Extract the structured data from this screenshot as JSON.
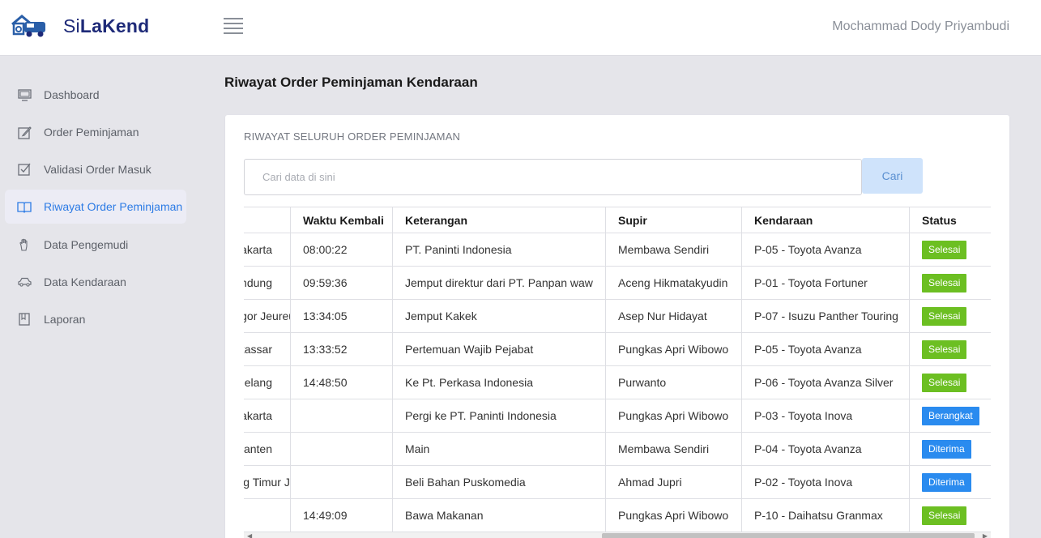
{
  "app": {
    "name_prefix": "Si",
    "name_bold": "LaKend",
    "user_name": "Mochammad Dody Priyambudi"
  },
  "sidebar": {
    "items": [
      {
        "label": "Dashboard",
        "icon": "monitor-icon",
        "active": false
      },
      {
        "label": "Order Peminjaman",
        "icon": "edit-icon",
        "active": false
      },
      {
        "label": "Validasi Order Masuk",
        "icon": "checkbox-icon",
        "active": false
      },
      {
        "label": "Riwayat Order Peminjaman",
        "icon": "book-icon",
        "active": true
      },
      {
        "label": "Data Pengemudi",
        "icon": "hand-icon",
        "active": false
      },
      {
        "label": "Data Kendaraan",
        "icon": "car-icon",
        "active": false
      },
      {
        "label": "Laporan",
        "icon": "report-icon",
        "active": false
      }
    ]
  },
  "main": {
    "page_title": "Riwayat Order Peminjaman Kendaraan",
    "card_title": "RIWAYAT SELURUH ORDER PEMINJAMAN",
    "search": {
      "placeholder": "Cari data di sini",
      "value": "",
      "button_label": "Cari"
    },
    "table": {
      "columns": [
        "",
        "Waktu Kembali",
        "Keterangan",
        "Supir",
        "Kendaraan",
        "Status"
      ],
      "rows": [
        {
          "c0": "Jakarta",
          "waktu_kembali": "08:00:22",
          "keterangan": "PT. Paninti Indonesia",
          "supir": "Membawa Sendiri",
          "kendaraan": "P-05 - Toyota Avanza",
          "status": "Selesai"
        },
        {
          "c0": "Bandung",
          "waktu_kembali": "09:59:36",
          "keterangan": "Jemput direktur dari PT. Panpan waw",
          "supir": "Aceng Hikmatakyudin",
          "kendaraan": "P-01 - Toyota Fortuner",
          "status": "Selesai"
        },
        {
          "c0": "Jatinangor Jeureum",
          "waktu_kembali": "13:34:05",
          "keterangan": "Jemput Kakek",
          "supir": "Asep Nur Hidayat",
          "kendaraan": "P-07 - Isuzu Panther Touring",
          "status": "Selesai"
        },
        {
          "c0": "Makassar",
          "waktu_kembali": "13:33:52",
          "keterangan": "Pertemuan Wajib Pejabat",
          "supir": "Pungkas Apri Wibowo",
          "kendaraan": "P-05 - Toyota Avanza",
          "status": "Selesai"
        },
        {
          "c0": "Magelang",
          "waktu_kembali": "14:48:50",
          "keterangan": "Ke Pt. Perkasa Indonesia",
          "supir": "Purwanto",
          "kendaraan": "P-06 - Toyota Avanza Silver",
          "status": "Selesai"
        },
        {
          "c0": "Jakarta",
          "waktu_kembali": "",
          "keterangan": "Pergi ke PT. Paninti Indonesia",
          "supir": "Pungkas Apri Wibowo",
          "kendaraan": "P-03 - Toyota Inova",
          "status": "Berangkat"
        },
        {
          "c0": "Banten",
          "waktu_kembali": "",
          "keterangan": "Main",
          "supir": "Membawa Sendiri",
          "kendaraan": "P-04 - Toyota Avanza",
          "status": "Diterima"
        },
        {
          "c0": "Bandung Timur Jawa Tengah Sahi",
          "waktu_kembali": "",
          "keterangan": "Beli Bahan Puskomedia",
          "supir": "Ahmad Jupri",
          "kendaraan": "P-02 - Toyota Inova",
          "status": "Diterima"
        },
        {
          "c0": "",
          "waktu_kembali": "14:49:09",
          "keterangan": "Bawa Makanan",
          "supir": "Pungkas Apri Wibowo",
          "kendaraan": "P-10 - Daihatsu Granmax",
          "status": "Selesai"
        }
      ]
    },
    "status_colors": {
      "Selesai": "#6cbf22",
      "Berangkat": "#2a8bef",
      "Diterima": "#2a8bef"
    }
  }
}
